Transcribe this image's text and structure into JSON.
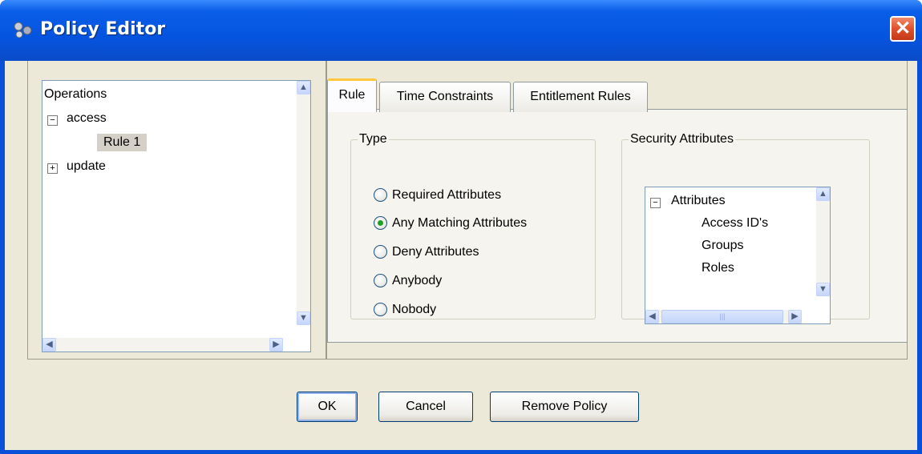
{
  "window": {
    "title": "Policy Editor",
    "close_glyph": "✕"
  },
  "tree": {
    "root": "Operations",
    "nodes": [
      {
        "label": "access",
        "expander": "−"
      },
      {
        "label": "Rule 1"
      },
      {
        "label": "update",
        "expander": "+"
      }
    ]
  },
  "tabs": [
    {
      "label": "Rule",
      "active": true
    },
    {
      "label": "Time Constraints"
    },
    {
      "label": "Entitlement Rules"
    }
  ],
  "type_group": {
    "legend": "Type",
    "options": [
      {
        "label": "Required Attributes",
        "checked": false
      },
      {
        "label": "Any Matching Attributes",
        "checked": true
      },
      {
        "label": "Deny Attributes",
        "checked": false
      },
      {
        "label": "Anybody",
        "checked": false
      },
      {
        "label": "Nobody",
        "checked": false
      }
    ]
  },
  "security_group": {
    "legend": "Security Attributes",
    "root": "Attributes",
    "root_expander": "−",
    "items": [
      "Access ID's",
      "Groups",
      "Roles"
    ]
  },
  "buttons": {
    "ok": "OK",
    "cancel": "Cancel",
    "remove": "Remove Policy"
  },
  "icons": {
    "scroll_up": "▲",
    "scroll_down": "▼",
    "scroll_left": "◀",
    "scroll_right": "▶",
    "thumb_grip": "|||"
  },
  "colors": {
    "title_bar": "#0a5ee8",
    "dialog_bg": "#ece9d8",
    "close_button": "#e0502c",
    "tab_highlight": "#ffc83c",
    "radio_checked": "#21a121"
  }
}
